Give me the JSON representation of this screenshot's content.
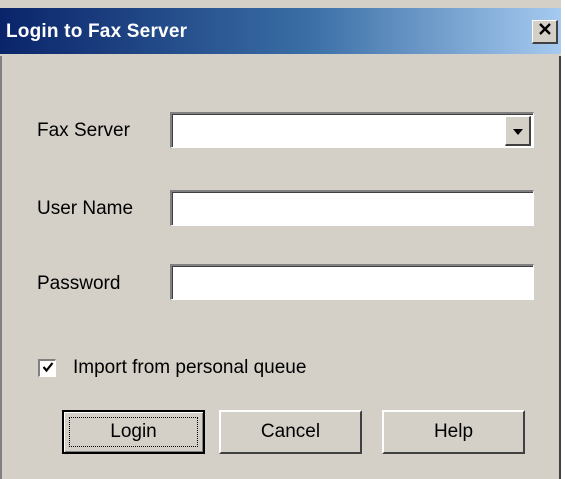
{
  "window": {
    "title": "Login to Fax Server",
    "close_glyph": "×"
  },
  "form": {
    "fax_server_label": "Fax Server",
    "fax_server_value": "",
    "user_name_label": "User Name",
    "user_name_value": "",
    "password_label": "Password",
    "password_value": "",
    "import_checkbox_label": "Import from personal queue",
    "import_checked": true
  },
  "buttons": {
    "login": "Login",
    "cancel": "Cancel",
    "help": "Help"
  },
  "colors": {
    "titlebar_start": "#0a246a",
    "titlebar_end": "#a6caf0",
    "dialog_face": "#d4d0c8"
  }
}
